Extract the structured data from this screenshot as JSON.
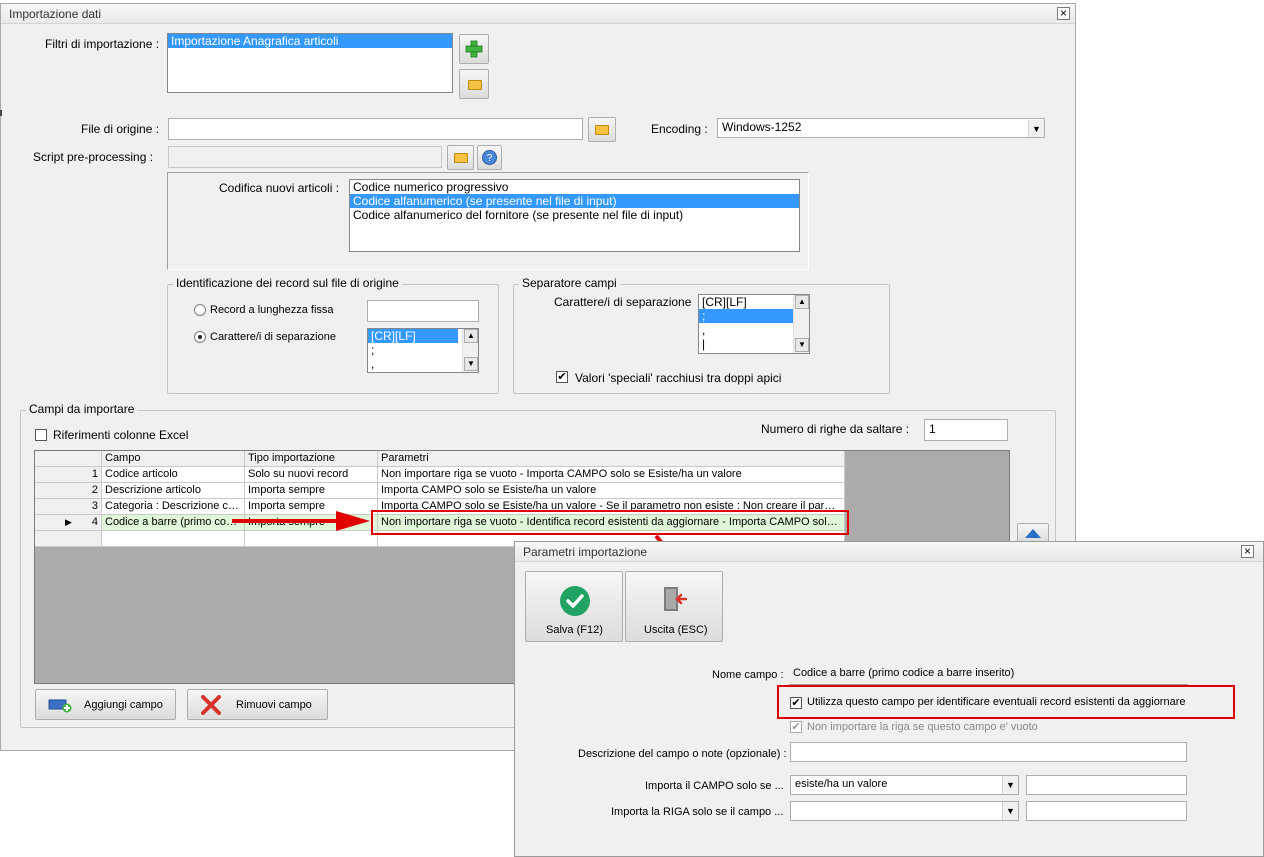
{
  "main": {
    "title": "Importazione dati",
    "close": "×",
    "filters_label": "Filtri di importazione :",
    "filters": [
      "Importazione Anagrafica articoli"
    ],
    "file_label": "File di origine :",
    "file_value": "",
    "encoding_label": "Encoding :",
    "encoding_value": "Windows-1252",
    "script_label": "Script pre-processing :",
    "codifica_label": "Codifica nuovi articoli :",
    "codifica_options": [
      "Codice numerico progressivo",
      "Codice alfanumerico (se presente nel file di input)",
      "Codice alfanumerico del fornitore (se presente nel file di input)"
    ],
    "ident_group": "Identificazione dei record sul file di origine",
    "radio_fixed": "Record a lunghezza fissa",
    "radio_sep": "Carattere/i di separazione",
    "ident_sep_items": [
      "[CR][LF]",
      ";",
      ","
    ],
    "sep_group": "Separatore campi",
    "sep_label": "Carattere/i di separazione",
    "sep_items": [
      "[CR][LF]",
      ";",
      ",",
      "|"
    ],
    "quotes_label": "Valori 'speciali' racchiusi tra doppi apici",
    "campi_group": "Campi da importare",
    "excel_ref_label": "Riferimenti colonne Excel",
    "skip_label": "Numero di righe da saltare :",
    "skip_value": "1",
    "grid_headers": [
      "Campo",
      "Tipo importazione",
      "Parametri"
    ],
    "grid_rows": [
      {
        "n": "1",
        "campo": "Codice articolo",
        "tipo": "Solo su nuovi record",
        "param": "Non importare riga se vuoto - Importa CAMPO solo se Esiste/ha un valore"
      },
      {
        "n": "2",
        "campo": "Descrizione articolo",
        "tipo": "Importa sempre",
        "param": "Importa CAMPO solo se Esiste/ha un valore"
      },
      {
        "n": "3",
        "campo": "Categoria : Descrizione co...",
        "tipo": "Importa sempre",
        "param": "Importa CAMPO solo se Esiste/ha un valore - Se il parametro non esiste : Non creare il param..."
      },
      {
        "n": "4",
        "campo": "Codice a barre (primo codi...",
        "tipo": "Importa sempre",
        "param": "Non importare riga se vuoto - Identifica record esistenti da aggiornare - Importa CAMPO solo ..."
      }
    ],
    "add_field": "Aggiungi campo",
    "remove_field": "Rimuovi campo"
  },
  "dialog": {
    "title": "Parametri importazione",
    "close": "×",
    "save": "Salva (F12)",
    "exit": "Uscita (ESC)",
    "nome_label": "Nome campo :",
    "nome_value": "Codice a barre (primo codice a barre inserito)",
    "use_identify": "Utilizza questo campo per identificare eventuali record esistenti da aggiornare",
    "skip_empty": "Non importare la riga se questo campo e' vuoto",
    "desc_label": "Descrizione del campo o note (opzionale) :",
    "desc_value": "",
    "import_field_label": "Importa il CAMPO solo se ...",
    "import_field_value": "esiste/ha un valore",
    "import_row_label": "Importa la RIGA solo se il campo ...",
    "import_row_value": ""
  },
  "colors": {
    "accent": "#3399ff",
    "highlight_red": "#e00000",
    "row_green": "#dff7d8",
    "save_green": "#21a366"
  },
  "icons": [
    "plus-icon",
    "folder-icon",
    "help-icon",
    "add-field-icon",
    "remove-x-icon",
    "check-circle-icon",
    "exit-door-icon",
    "arrow-right-icon",
    "scroll-up-icon"
  ]
}
